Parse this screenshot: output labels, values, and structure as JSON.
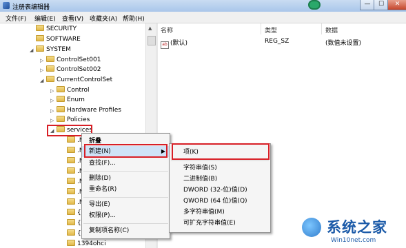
{
  "window": {
    "title": "注册表编辑器",
    "min": "—",
    "max": "☐",
    "close": "✕"
  },
  "menubar": [
    "文件(F)",
    "编辑(E)",
    "查看(V)",
    "收藏夹(A)",
    "帮助(H)"
  ],
  "tree": [
    "SECURITY",
    "SOFTWARE",
    "SYSTEM",
    "ControlSet001",
    "ControlSet002",
    "CurrentControlSet",
    "Control",
    "Enum",
    "Hardware Profiles",
    "Policies",
    "services",
    ".N",
    ".N",
    ".N",
    ".N",
    ".N",
    ".N",
    ".N",
    "{0A",
    "{5F",
    "{E4",
    "1394ohci"
  ],
  "list": {
    "headers": {
      "name": "名称",
      "type": "类型",
      "data": "数据"
    },
    "rows": [
      {
        "name": "(默认)",
        "type": "REG_SZ",
        "data": "(数值未设置)"
      }
    ]
  },
  "context_menu": {
    "collapse": "折叠",
    "new": "新建(N)",
    "find": "查找(F)...",
    "delete": "删除(D)",
    "rename": "重命名(R)",
    "export": "导出(E)",
    "permissions": "权限(P)...",
    "copy_name": "复制项名称(C)"
  },
  "submenu": {
    "key": "项(K)",
    "string": "字符串值(S)",
    "binary": "二进制值(B)",
    "dword": "DWORD (32-位)值(D)",
    "qword": "QWORD (64 位)值(Q)",
    "multi": "多字符串值(M)",
    "expand": "可扩充字符串值(E)"
  },
  "watermark": {
    "brand": "系统之家",
    "url": "Win10net.com"
  }
}
